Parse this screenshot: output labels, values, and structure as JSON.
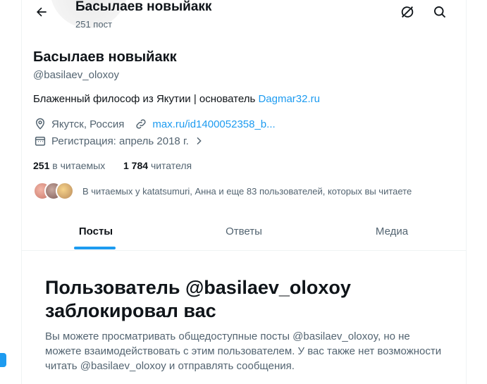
{
  "header": {
    "title": "Басылаев новыйакк",
    "subtitle": "251 пост",
    "back_icon": "arrow-left-icon",
    "grok_icon": "grok-icon",
    "search_icon": "search-icon"
  },
  "profile": {
    "name": "Басылаев новыйакк",
    "handle": "@basilaev_oloxoy",
    "bio_text": "Блаженный философ из Якутии | основатель ",
    "bio_link": "Dagmar32.ru",
    "location": "Якутск, Россия",
    "website": "max.ru/id1400052358_b...",
    "joined": "Регистрация: апрель 2018 г.",
    "following_count": "251",
    "following_label": "в читаемых",
    "followers_count": "1 784",
    "followers_label": "читателя",
    "followed_by": "В читаемых у katatsumuri, Анна и еще 83 пользователей, которых вы читаете"
  },
  "tabs": [
    {
      "label": "Посты",
      "active": true
    },
    {
      "label": "Ответы",
      "active": false
    },
    {
      "label": "Медиа",
      "active": false
    }
  ],
  "blocked": {
    "title": "Пользователь @basilaev_oloxoy заблокировал вас",
    "text": "Вы можете просматривать общедоступные посты @basilaev_oloxoy, но не можете взаимодействовать с этим пользователем. У вас также нет возможности читать @basilaev_oloxoy и отправлять сообщения."
  },
  "colors": {
    "accent": "#1d9bf0",
    "text": "#0f1419",
    "secondary": "#536471"
  }
}
